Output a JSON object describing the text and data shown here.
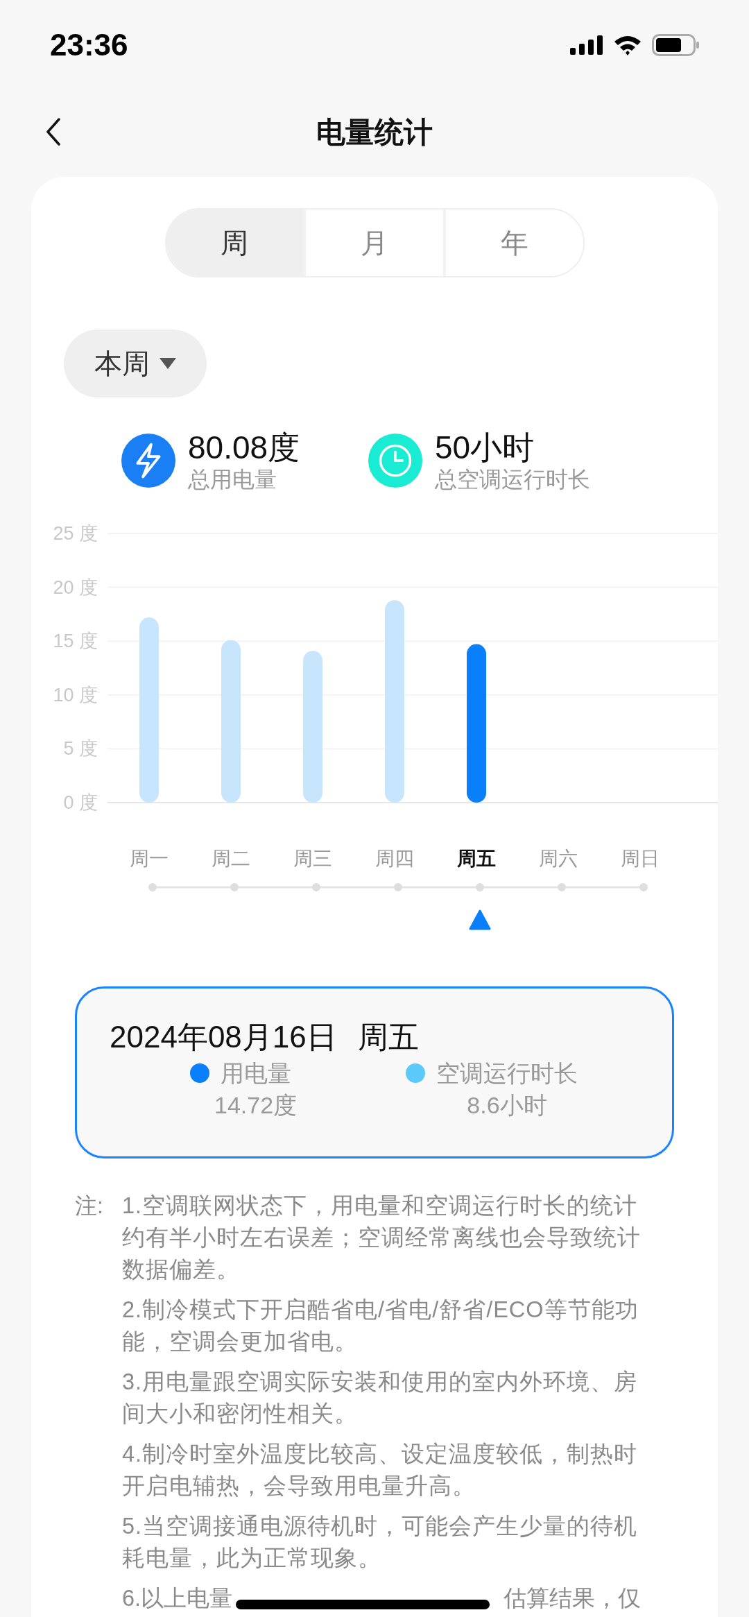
{
  "status_bar": {
    "time": "23:36"
  },
  "header": {
    "title": "电量统计"
  },
  "period_tabs": [
    {
      "label": "周",
      "selected": true
    },
    {
      "label": "月",
      "selected": false
    },
    {
      "label": "年",
      "selected": false
    }
  ],
  "range_dropdown": {
    "label": "本周"
  },
  "summary": [
    {
      "value": "80.08度",
      "label": "总用电量",
      "kind": "power",
      "color": "#1a7ff5"
    },
    {
      "value": "50小时",
      "label": "总空调运行时长",
      "kind": "clock",
      "color": "#19ecd3"
    }
  ],
  "chart_data": {
    "type": "bar",
    "categories": [
      "周一",
      "周二",
      "周三",
      "周四",
      "周五",
      "周六",
      "周日"
    ],
    "values": [
      17.2,
      15.1,
      14.1,
      18.8,
      14.72,
      null,
      null
    ],
    "grid": true,
    "ylim": [
      0,
      25
    ],
    "yticks": [
      {
        "value": 0,
        "label": "0 度"
      },
      {
        "value": 5,
        "label": "5 度"
      },
      {
        "value": 10,
        "label": "10 度"
      },
      {
        "value": 15,
        "label": "15 度"
      },
      {
        "value": 20,
        "label": "20 度"
      },
      {
        "value": 25,
        "label": "25 度"
      }
    ]
  },
  "day_timeline": [
    {
      "selected": false
    },
    {
      "selected": false
    },
    {
      "selected": false
    },
    {
      "selected": false
    },
    {
      "selected": true
    },
    {
      "selected": false
    },
    {
      "selected": false
    }
  ],
  "detail_card": {
    "date": "2024年08月16日",
    "weekday": "周五",
    "items": [
      {
        "label": "用电量",
        "value": "14.72度",
        "color": "#0a7ffb"
      },
      {
        "label": "空调运行时长",
        "value": "8.6小时",
        "color": "#5ccaf8"
      }
    ]
  },
  "notes": {
    "label": "注:",
    "items": [
      "1.空调联网状态下，用电量和空调运行时长的统计约有半小时左右误差；空调经常离线也会导致统计数据偏差。",
      "2.制冷模式下开启酷省电/省电/舒省/ECO等节能功能，空调会更加省电。",
      "3.用电量跟空调实际安装和使用的室内外环境、房间大小和密闭性相关。",
      "4.制冷时室外温度比较高、设定温度较低，制热时开启电辅热，会导致用电量升高。",
      "5.当空调接通电源待机时，可能会产生少量的待机耗电量，此为正常现象。"
    ],
    "partly_hidden_item": [
      "6.以上电量",
      "估算结果，仅"
    ]
  }
}
